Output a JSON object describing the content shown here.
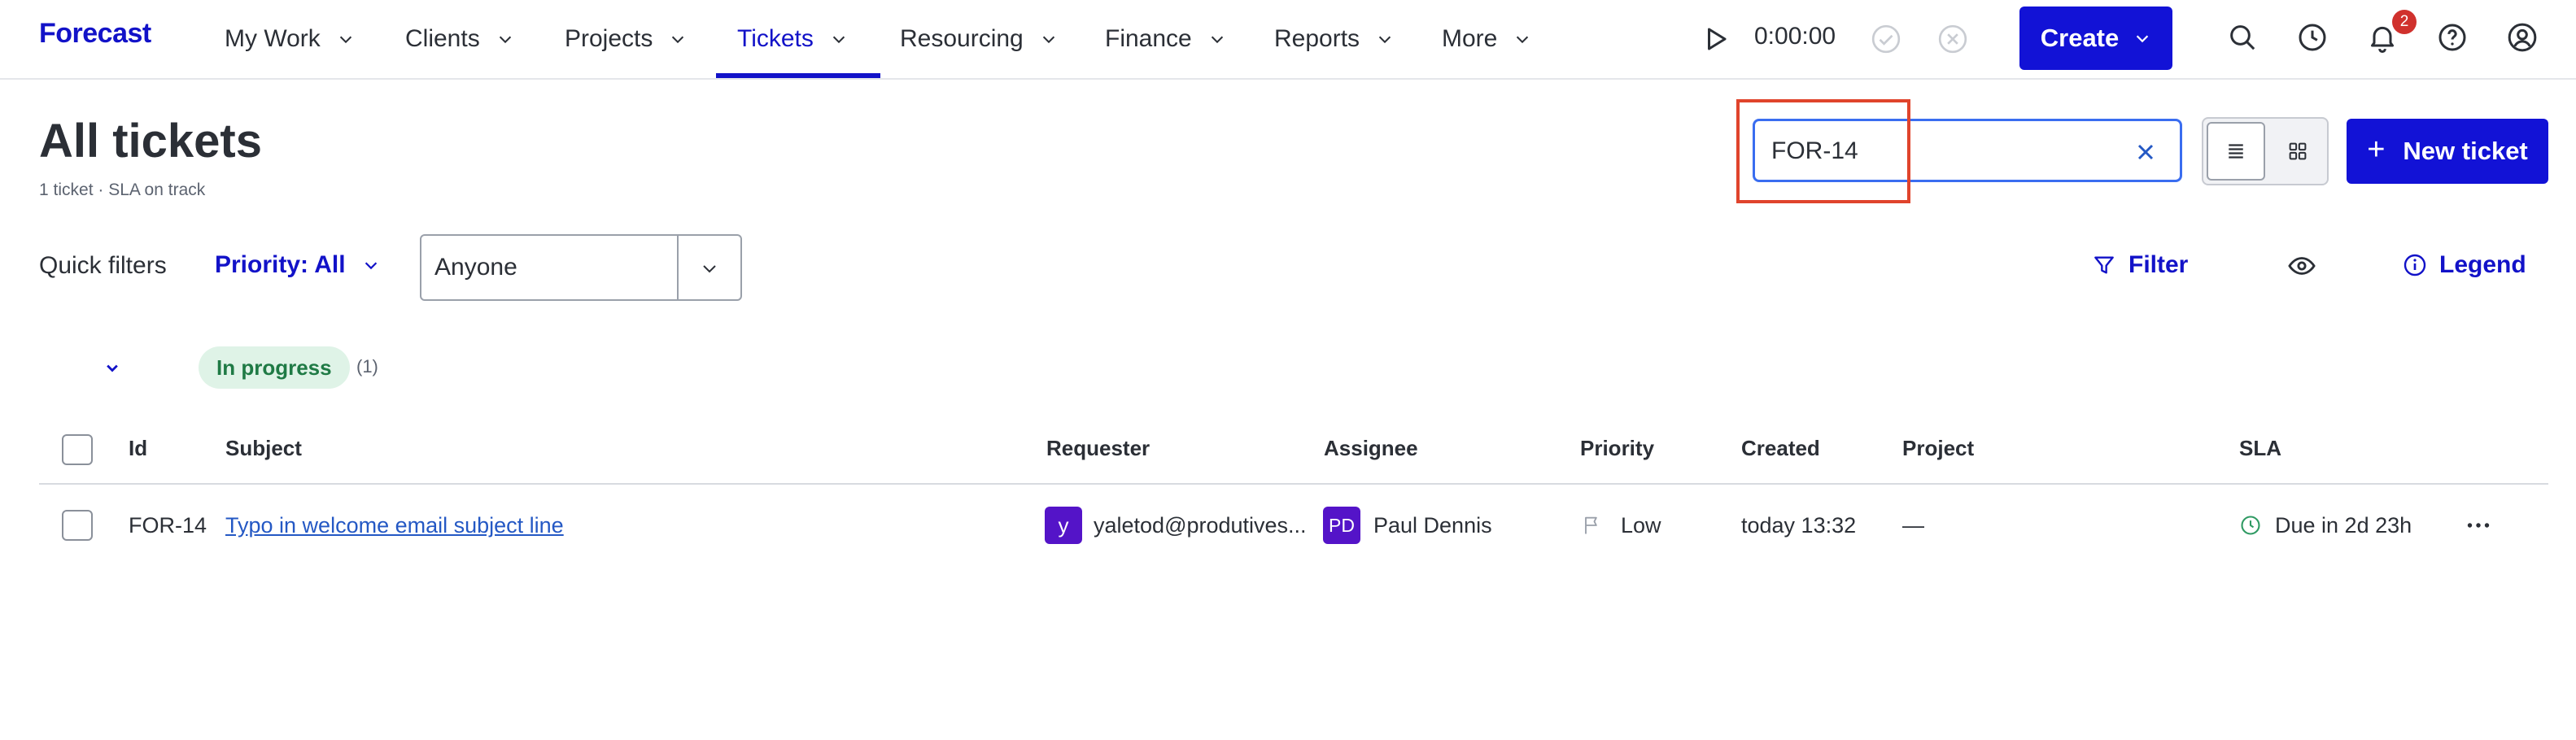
{
  "nav": {
    "logo": "Forecast",
    "items": [
      {
        "label": "My Work"
      },
      {
        "label": "Clients"
      },
      {
        "label": "Projects"
      },
      {
        "label": "Tickets"
      },
      {
        "label": "Resourcing"
      },
      {
        "label": "Finance"
      },
      {
        "label": "Reports"
      },
      {
        "label": "More"
      }
    ],
    "active": "Tickets",
    "timer": "0:00:00",
    "create_label": "Create",
    "notifications_count": "2",
    "icons": [
      "search-icon",
      "history-clock-icon",
      "bell-icon",
      "help-icon",
      "user-profile-icon"
    ]
  },
  "header": {
    "title": "All tickets",
    "subtitle": "1 ticket · SLA on track",
    "search_value": "FOR-14",
    "new_ticket_label": "New ticket"
  },
  "filters": {
    "quick_filters_label": "Quick filters",
    "priority_label": "Priority: All",
    "assignee_value": "Anyone",
    "filter_label": "Filter",
    "legend_label": "Legend"
  },
  "group": {
    "status": "In progress",
    "count": "(1)"
  },
  "table": {
    "columns": {
      "id": "Id",
      "subject": "Subject",
      "requester": "Requester",
      "assignee": "Assignee",
      "priority": "Priority",
      "created": "Created",
      "project": "Project",
      "sla": "SLA"
    },
    "rows": [
      {
        "id": "FOR-14",
        "subject": "Typo in welcome email subject line",
        "requester_initial": "y",
        "requester": "yaletod@produtives...",
        "assignee_initials": "PD",
        "assignee": "Paul Dennis",
        "priority": "Low",
        "created": "today 13:32",
        "project": "—",
        "sla": "Due in 2d 23h"
      }
    ]
  },
  "colors": {
    "brand": "#1212c8",
    "primary_button": "#1212d6",
    "highlight": "#e0442c",
    "status_pill_bg": "#dff3e7",
    "status_pill_text": "#1f7a45",
    "avatar": "#5414c8",
    "link": "#2458c4"
  }
}
